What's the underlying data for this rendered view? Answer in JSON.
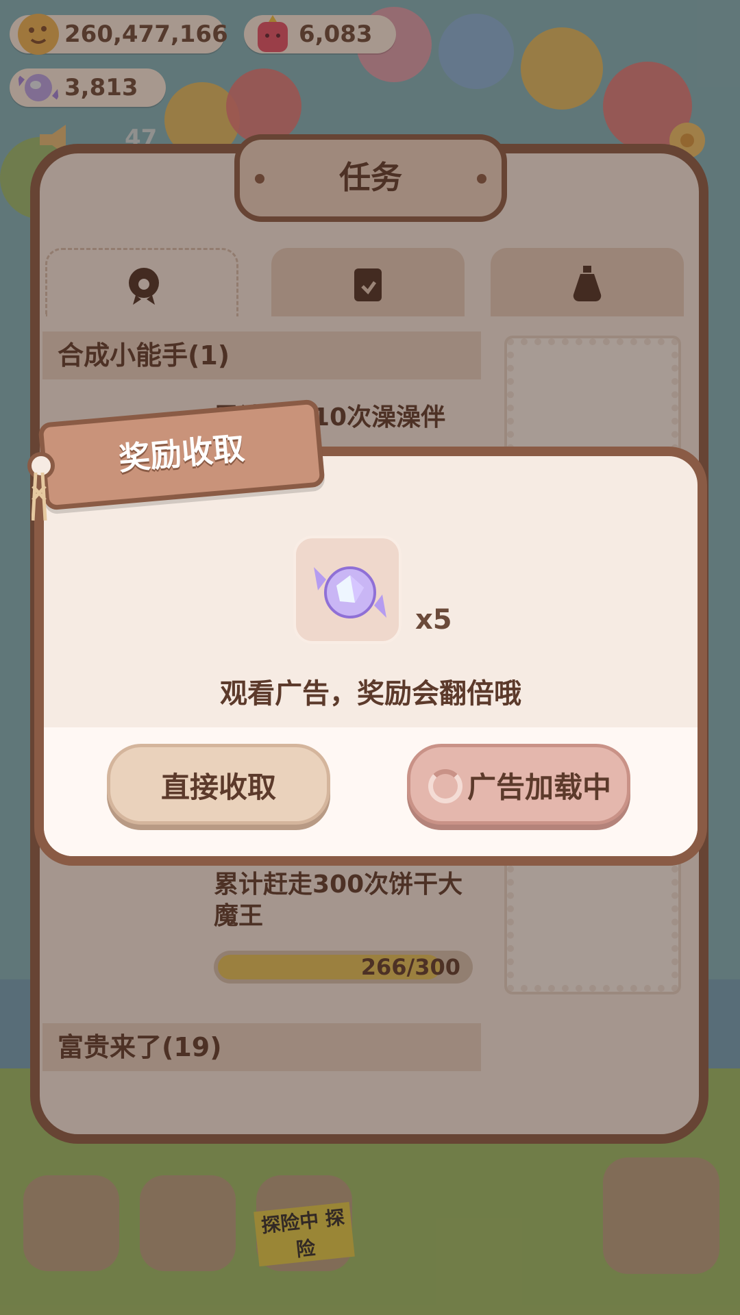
{
  "resources": {
    "cookies": "260,477,166",
    "gems": "6,083",
    "candies": "3,813"
  },
  "notification_count": "47",
  "task_panel": {
    "title": "任务",
    "tabs": [
      "badge-tab",
      "clipboard-tab",
      "potion-tab"
    ],
    "section_1": "合成小能手(1)",
    "task_1_text": "累计合成10次澡澡伴",
    "task_2_text_line1": "累计赶走300次饼干大",
    "task_2_text_line2": "魔王",
    "task_2_progress": "266/300",
    "task_2_progress_value": 0.8867,
    "section_2": "富贵来了(19)"
  },
  "reward_dialog": {
    "title": "奖励收取",
    "item_icon": "crystal-candy-icon",
    "item_quantity": "x5",
    "message": "观看广告，奖励会翻倍哦",
    "collect_button": "直接收取",
    "ad_button": "广告加载中"
  },
  "bottom_bar": {
    "adventure_label": "探险中 探险"
  },
  "colors": {
    "panel_border": "#8a5b45",
    "panel_bg": "#fbf1ea",
    "text_brown": "#5c3a2b",
    "progress_fill": "#e9c85a"
  }
}
